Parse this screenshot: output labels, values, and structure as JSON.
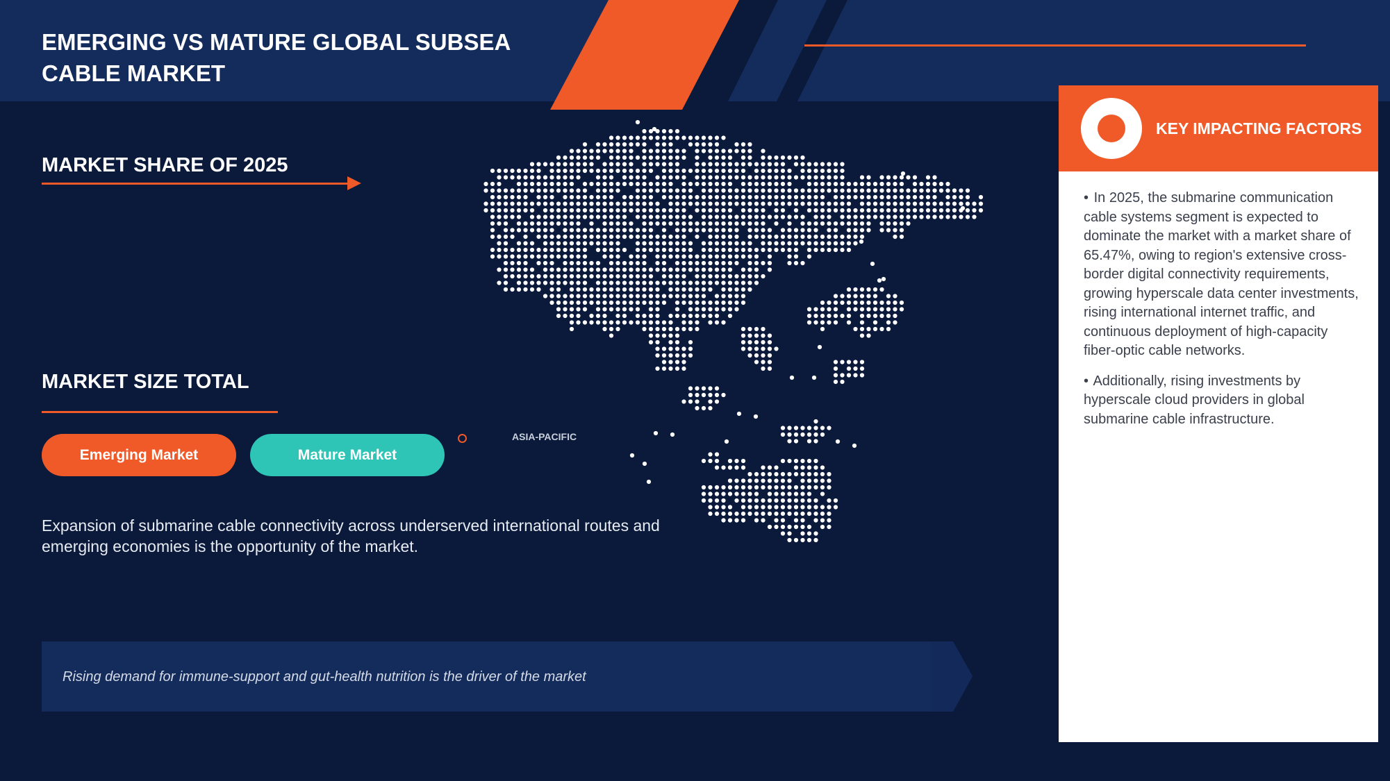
{
  "header": {
    "title": "EMERGING VS MATURE GLOBAL SUBSEA CABLE MARKET"
  },
  "market_share": {
    "heading": "MARKET SHARE OF 2025"
  },
  "market_size": {
    "heading": "MARKET SIZE TOTAL"
  },
  "buttons": {
    "emerging": "Emerging Market",
    "mature": "Mature Market"
  },
  "map": {
    "region_label": "ASIA-PACIFIC"
  },
  "opportunity": {
    "text": "Expansion of submarine cable connectivity across underserved international routes and emerging economies is the opportunity of the market."
  },
  "driver": {
    "text": "Rising demand for immune-support and gut-health nutrition is the driver of the market"
  },
  "key_factors": {
    "title": "KEY IMPACTING FACTORS",
    "bullets": [
      "In 2025, the submarine communication cable systems segment is expected to dominate the market with a market share of 65.47%, owing to region's extensive cross-border digital connectivity requirements, growing hyperscale data center investments, rising international internet traffic, and continuous deployment of high-capacity fiber-optic cable networks.",
      "Additionally, rising investments by hyperscale cloud providers in global submarine cable infrastructure."
    ]
  },
  "colors": {
    "background": "#0b1a3a",
    "header": "#142c5c",
    "accent_orange": "#f05a28",
    "accent_teal": "#2ec4b6",
    "panel": "#ffffff"
  }
}
